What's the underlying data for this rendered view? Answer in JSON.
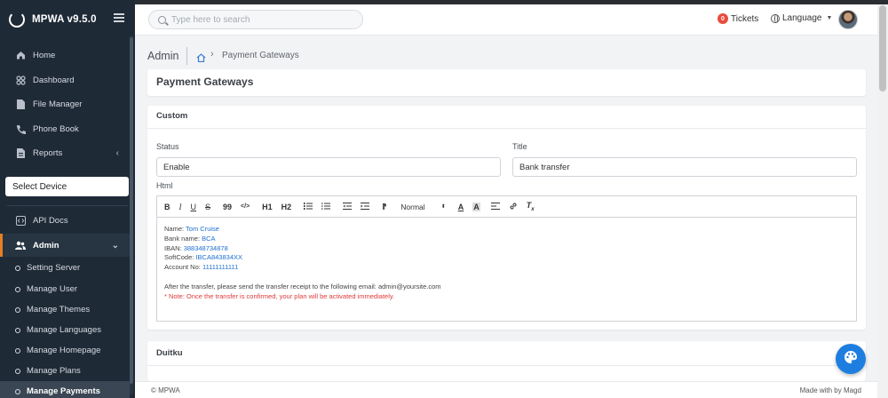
{
  "app": {
    "title": "MPWA v9.5.0"
  },
  "header": {
    "search_placeholder": "Type here to search",
    "tickets_label": "Tickets",
    "tickets_count": "0",
    "language_label": "Language"
  },
  "sidebar": {
    "items": [
      {
        "label": "Home",
        "icon": "home-icon"
      },
      {
        "label": "Dashboard",
        "icon": "dashboard-icon"
      },
      {
        "label": "File Manager",
        "icon": "file-icon"
      },
      {
        "label": "Phone Book",
        "icon": "phone-icon"
      },
      {
        "label": "Reports",
        "icon": "reports-icon"
      }
    ],
    "select_device": "Select Device",
    "api_docs": "API Docs",
    "admin": "Admin",
    "admin_subitems": [
      "Setting Server",
      "Manage User",
      "Manage Themes",
      "Manage Languages",
      "Manage Homepage",
      "Manage Plans",
      "Manage Payments"
    ]
  },
  "breadcrumb": {
    "section": "Admin",
    "page": "Payment Gateways"
  },
  "page": {
    "title": "Payment Gateways"
  },
  "custom_card": {
    "title": "Custom",
    "status_label": "Status",
    "status_value": "Enable",
    "title_label": "Title",
    "title_value": "Bank transfer",
    "html_label": "Html",
    "toolbar": {
      "bold": "B",
      "italic": "I",
      "underline": "U",
      "strike": "S",
      "quote": "99",
      "code": "</>",
      "h1": "H1",
      "h2": "H2",
      "format": "Normal"
    },
    "editor_lines": {
      "name_key": "Name:",
      "name_val": "Tom Cruise",
      "bank_key": "Bank name:",
      "bank_val": "BCA",
      "iban_key": "IBAN:",
      "iban_val": "388348734878",
      "soft_key": "SoftCode:",
      "soft_val": "IBCA843834XX",
      "acct_key": "Account No:",
      "acct_val": "11111111111",
      "instructions": "After the transfer, please send the transfer receipt to the following email: admin@yoursite.com",
      "note": "* Note: Once the transfer is confirmed, your plan will be activated immediately."
    }
  },
  "duitku_card": {
    "title": "Duitku"
  },
  "footer": {
    "copyright": "© MPWA",
    "credit": "Made with by Magd"
  },
  "colors": {
    "sidebar": "#1f2a37",
    "accent": "#1e7ee0",
    "active_border": "#e67e22",
    "note": "#e03a3a",
    "link": "#1f6fd1"
  }
}
